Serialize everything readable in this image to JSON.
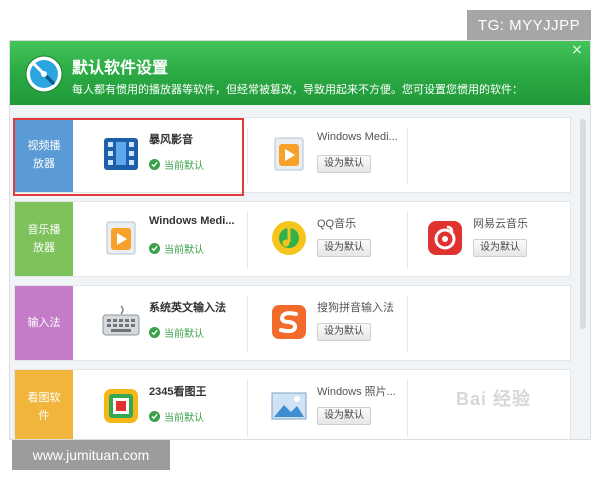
{
  "overlay": {
    "tg_badge": "TG: MYYJJPP",
    "site_watermark": "www.jumituan.com",
    "baidu_watermark": "Bai 经验"
  },
  "window": {
    "title": "默认软件设置",
    "subtitle": "每人都有惯用的播放器等软件，但经常被篡改，导致用起来不方便。您可设置您惯用的软件：",
    "close_label": "×"
  },
  "rows": [
    {
      "category": "视频播放器",
      "category_color": "#5b9bd5",
      "apps": [
        {
          "name": "暴风影音",
          "status": "当前默认",
          "icon": "film-player-icon"
        },
        {
          "name": "Windows Medi...",
          "button": "设为默认",
          "icon": "media-player-icon"
        }
      ]
    },
    {
      "category": "音乐播放器",
      "category_color": "#7dc25a",
      "apps": [
        {
          "name": "Windows Medi...",
          "status": "当前默认",
          "icon": "media-player-icon"
        },
        {
          "name": "QQ音乐",
          "button": "设为默认",
          "icon": "qq-music-icon"
        },
        {
          "name": "网易云音乐",
          "button": "设为默认",
          "icon": "netease-music-icon"
        }
      ]
    },
    {
      "category": "输入法",
      "category_color": "#c47cc9",
      "apps": [
        {
          "name": "系统英文输入法",
          "status": "当前默认",
          "icon": "keyboard-icon"
        },
        {
          "name": "搜狗拼音输入法",
          "button": "设为默认",
          "icon": "sogou-input-icon"
        }
      ]
    },
    {
      "category": "看图软件",
      "category_color": "#f0b53a",
      "apps": [
        {
          "name": "2345看图王",
          "status": "当前默认",
          "icon": "image-viewer-icon"
        },
        {
          "name": "Windows 照片...",
          "button": "设为默认",
          "icon": "photo-viewer-icon"
        }
      ]
    }
  ]
}
